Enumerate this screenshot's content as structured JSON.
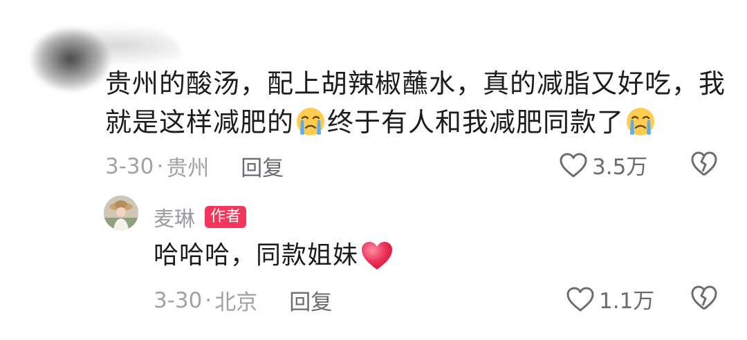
{
  "comment": {
    "text_part1": "贵州的酸汤，配上胡辣椒蘸水，真的减脂又好吃，我就是这样减肥的",
    "text_part2": "终于有人和我减肥同款了",
    "emoji": "crying-face-emoji",
    "date": "3-30",
    "separator": "·",
    "location": "贵州",
    "reply_label": "回复",
    "like_count": "3.5万"
  },
  "reply": {
    "username": "麦琳",
    "badge": "作者",
    "text": "哈哈哈，同款姐妹",
    "emoji": "red-heart-emoji",
    "date": "3-30",
    "separator": "·",
    "location": "北京",
    "reply_label": "回复",
    "like_count": "1.1万"
  },
  "colors": {
    "text": "#1c1c1e",
    "meta": "#a1a1a6",
    "badge": "#f5365c",
    "heart": "#f0335a"
  }
}
